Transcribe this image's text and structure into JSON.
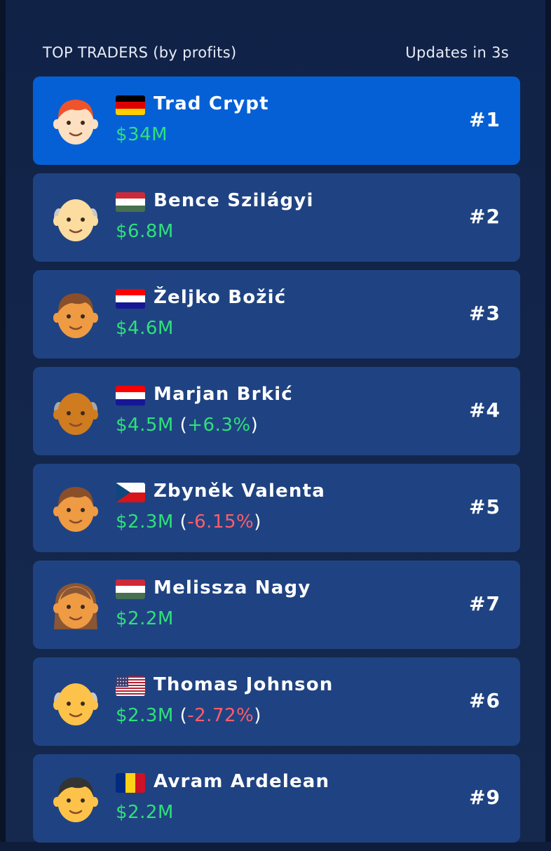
{
  "header": {
    "title": "TOP TRADERS (by profits)",
    "update_status": "Updates in 3s"
  },
  "traders": [
    {
      "name": "Trad Crypt",
      "profit": "$34M",
      "change": "",
      "change_dir": "",
      "rank": "#1",
      "flag": "germany",
      "avatar": "red-hair-young",
      "active": true
    },
    {
      "name": "Bence Szilágyi",
      "profit": "$6.8M",
      "change": "",
      "change_dir": "",
      "rank": "#2",
      "flag": "hungary",
      "avatar": "bald-elder-light",
      "active": false
    },
    {
      "name": "Željko Božić",
      "profit": "$4.6M",
      "change": "",
      "change_dir": "",
      "rank": "#3",
      "flag": "croatia",
      "avatar": "brown-hair-tan",
      "active": false
    },
    {
      "name": "Marjan Brkić",
      "profit": "$4.5M",
      "change": "+6.3%",
      "change_dir": "up",
      "rank": "#4",
      "flag": "croatia",
      "avatar": "bald-elder-dark",
      "active": false
    },
    {
      "name": "Zbyněk Valenta",
      "profit": "$2.3M",
      "change": "-6.15%",
      "change_dir": "down",
      "rank": "#5",
      "flag": "czech",
      "avatar": "brown-hair-tan",
      "active": false
    },
    {
      "name": "Melissza Nagy",
      "profit": "$2.2M",
      "change": "",
      "change_dir": "",
      "rank": "#7",
      "flag": "hungary",
      "avatar": "long-hair-woman",
      "active": false
    },
    {
      "name": "Thomas Johnson",
      "profit": "$2.3M",
      "change": "-2.72%",
      "change_dir": "down",
      "rank": "#6",
      "flag": "usa",
      "avatar": "bald-elder-yellow",
      "active": false
    },
    {
      "name": "Avram Ardelean",
      "profit": "$2.2M",
      "change": "",
      "change_dir": "",
      "rank": "#9",
      "flag": "romania",
      "avatar": "dark-hair-yellow",
      "active": false
    }
  ],
  "colors": {
    "accent_active": "#0560d6",
    "row_bg": "#1f4382",
    "profit_green": "#2ee07a",
    "loss_red": "#ff5d6a"
  }
}
